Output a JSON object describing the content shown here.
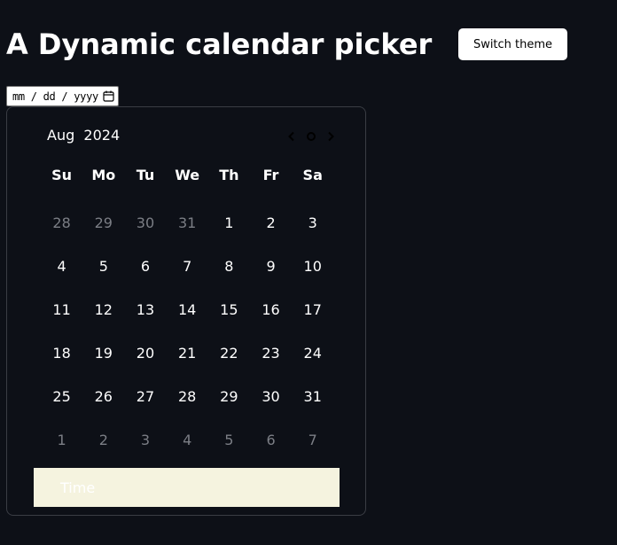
{
  "page": {
    "title": "A Dynamic calendar picker",
    "switch_theme_label": "Switch theme"
  },
  "date_input": {
    "placeholder": "mm / dd / yyyy",
    "icon": "calendar-icon"
  },
  "picker": {
    "month": "Aug",
    "year": "2024",
    "nav_icons": [
      "chevron-left-icon",
      "circle-today-icon",
      "chevron-right-icon"
    ],
    "weekdays": [
      "Su",
      "Mo",
      "Tu",
      "We",
      "Th",
      "Fr",
      "Sa"
    ],
    "weeks": [
      [
        {
          "d": "28",
          "muted": true
        },
        {
          "d": "29",
          "muted": true
        },
        {
          "d": "30",
          "muted": true
        },
        {
          "d": "31",
          "muted": true
        },
        {
          "d": "1",
          "muted": false
        },
        {
          "d": "2",
          "muted": false
        },
        {
          "d": "3",
          "muted": false
        }
      ],
      [
        {
          "d": "4",
          "muted": false
        },
        {
          "d": "5",
          "muted": false
        },
        {
          "d": "6",
          "muted": false
        },
        {
          "d": "7",
          "muted": false
        },
        {
          "d": "8",
          "muted": false
        },
        {
          "d": "9",
          "muted": false
        },
        {
          "d": "10",
          "muted": false
        }
      ],
      [
        {
          "d": "11",
          "muted": false
        },
        {
          "d": "12",
          "muted": false
        },
        {
          "d": "13",
          "muted": false
        },
        {
          "d": "14",
          "muted": false
        },
        {
          "d": "15",
          "muted": false
        },
        {
          "d": "16",
          "muted": false
        },
        {
          "d": "17",
          "muted": false
        }
      ],
      [
        {
          "d": "18",
          "muted": false
        },
        {
          "d": "19",
          "muted": false
        },
        {
          "d": "20",
          "muted": false
        },
        {
          "d": "21",
          "muted": false
        },
        {
          "d": "22",
          "muted": false
        },
        {
          "d": "23",
          "muted": false
        },
        {
          "d": "24",
          "muted": false
        }
      ],
      [
        {
          "d": "25",
          "muted": false
        },
        {
          "d": "26",
          "muted": false
        },
        {
          "d": "27",
          "muted": false
        },
        {
          "d": "28",
          "muted": false
        },
        {
          "d": "29",
          "muted": false
        },
        {
          "d": "30",
          "muted": false
        },
        {
          "d": "31",
          "muted": false
        }
      ],
      [
        {
          "d": "1",
          "muted": true
        },
        {
          "d": "2",
          "muted": true
        },
        {
          "d": "3",
          "muted": true
        },
        {
          "d": "4",
          "muted": true
        },
        {
          "d": "5",
          "muted": true
        },
        {
          "d": "6",
          "muted": true
        },
        {
          "d": "7",
          "muted": true
        }
      ]
    ],
    "time_label": "Time"
  },
  "colors": {
    "background": "#0d1017",
    "muted_day": "#7b7e85",
    "time_bar": "#f5f3df"
  }
}
